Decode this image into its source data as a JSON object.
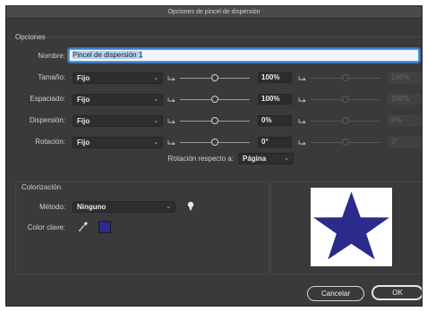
{
  "window": {
    "title": "Opciones de pincel de dispersión"
  },
  "opciones": {
    "section_title": "Opciones",
    "name_label": "Nombre:",
    "name_value": "Pincel de dispersión 1",
    "rows": [
      {
        "label": "Tamaño:",
        "method": "Fijo",
        "value": "100%",
        "value_max": "100%",
        "knob_level": 0.5
      },
      {
        "label": "Espaciado:",
        "method": "Fijo",
        "value": "100%",
        "value_max": "100%",
        "knob_level": 0.5
      },
      {
        "label": "Dispersión:",
        "method": "Fijo",
        "value": "0%",
        "value_max": "0%",
        "knob_level": 0.5
      },
      {
        "label": "Rotación:",
        "method": "Fijo",
        "value": "0°",
        "value_max": "0°",
        "knob_level": 0.5
      }
    ],
    "rotation_relative_label": "Rotación respecto a:",
    "rotation_relative_value": "Página"
  },
  "colorizacion": {
    "section_title": "Colorización",
    "method_label": "Método:",
    "method_value": "Ninguno",
    "key_color_label": "Color clave:",
    "key_color_hex": "#2c2a8a"
  },
  "preview": {
    "star_color": "#2c2a8a"
  },
  "buttons": {
    "cancel": "Cancelar",
    "ok": "OK"
  }
}
